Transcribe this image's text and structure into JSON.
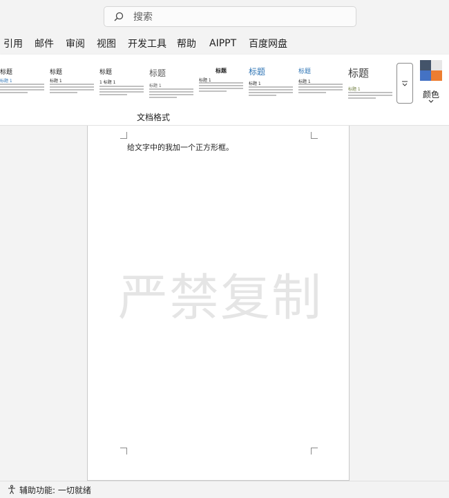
{
  "search": {
    "placeholder": "搜索"
  },
  "tabs": [
    {
      "label": "引用"
    },
    {
      "label": "邮件"
    },
    {
      "label": "审阅"
    },
    {
      "label": "视图"
    },
    {
      "label": "开发工具"
    },
    {
      "label": "帮助"
    },
    {
      "label": "AIPPT"
    },
    {
      "label": "百度网盘"
    }
  ],
  "ribbon": {
    "styles": [
      {
        "title": "标题",
        "h1": "标题 1"
      },
      {
        "title": "标题",
        "h1": "标题 1"
      },
      {
        "title": "标题",
        "h1": "1  标题 1"
      },
      {
        "title": "标题",
        "h1": "标题 1"
      },
      {
        "title": "标题",
        "h1": "标题 1"
      },
      {
        "title": "标题",
        "h1": "标题 1"
      },
      {
        "title": "标题",
        "h1": "标题 1"
      },
      {
        "title": "标题",
        "h1": "标题 1"
      }
    ],
    "colors_label": "颜色",
    "group_label": "文档格式",
    "theme_colors": [
      "#44546a",
      "#e7e6e6",
      "#4472c4",
      "#ed7d31"
    ],
    "accent_blue": "#2e74b5"
  },
  "document": {
    "text": "给文字中的我加一个正方形框。",
    "watermark": "严禁复制"
  },
  "status": {
    "accessibility": "辅助功能: 一切就绪"
  }
}
